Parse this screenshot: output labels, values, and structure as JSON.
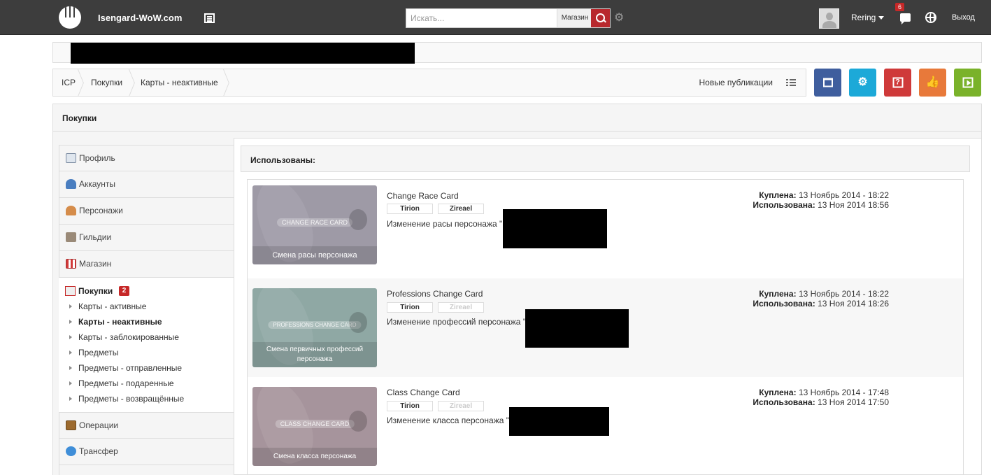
{
  "header": {
    "site_title": "Isengard-WoW.com",
    "search": {
      "placeholder": "Искать...",
      "scope": "Магазин"
    },
    "user": {
      "name": "Rering"
    },
    "notifications_count": "6",
    "logout": "Выход"
  },
  "breadcrumb": {
    "items": [
      "ICP",
      "Покупки",
      "Карты - неактивные"
    ],
    "new_publications": "Новые публикации"
  },
  "quick_buttons": [
    {
      "name": "shop",
      "color": "#3f5e9e"
    },
    {
      "name": "settings",
      "color": "#1ca9d8"
    },
    {
      "name": "help",
      "color": "#cf3a3a"
    },
    {
      "name": "vote",
      "color": "#e8793a"
    },
    {
      "name": "play",
      "color": "#7ab22a"
    }
  ],
  "section_title": "Покупки",
  "sidebar": {
    "top_items": [
      {
        "label": "Профиль",
        "icon": "profile-card-icon"
      },
      {
        "label": "Аккаунты",
        "icon": "accounts-icon"
      },
      {
        "label": "Персонажи",
        "icon": "characters-icon"
      },
      {
        "label": "Гильдии",
        "icon": "guild-icon"
      },
      {
        "label": "Магазин",
        "icon": "shop-icon"
      }
    ],
    "purchases": {
      "label": "Покупки",
      "badge": "2",
      "links": [
        "Карты - активные",
        "Карты - неактивные",
        "Карты - заблокированные",
        "Предметы",
        "Предметы - отправленные",
        "Предметы - подаренные",
        "Предметы - возвращённые"
      ],
      "active_index": 1
    },
    "bottom_items": [
      {
        "label": "Операции",
        "icon": "operations-icon"
      },
      {
        "label": "Трансфер",
        "icon": "transfer-icon"
      }
    ]
  },
  "used": {
    "title": "Использованы:",
    "purchased_label": "Куплена:",
    "used_label": "Использована:",
    "cards": [
      {
        "name": "Change Race Card",
        "stamp": "CHANGE RACE CARD",
        "caption": "Смена расы персонажа",
        "realms": [
          "Tirion",
          "Zireael"
        ],
        "realm_active": [
          true,
          true
        ],
        "description": "Изменение расы персонажа \"",
        "purchased": "13 Ноябрь 2014 - 18:22",
        "used": "13 Ноя 2014 18:56",
        "color": "#9e9aa6"
      },
      {
        "name": "Professions Change Card",
        "stamp": "PROFESSIONS CHANGE CARD",
        "caption": "Смена первичных профессий персонажа",
        "realms": [
          "Tirion",
          "Zireael"
        ],
        "realm_active": [
          true,
          false
        ],
        "description": "Изменение профессий персонажа \"",
        "purchased": "13 Ноябрь 2014 - 18:22",
        "used": "13 Ноя 2014 18:26",
        "color": "#8fa8a4"
      },
      {
        "name": "Class Change Card",
        "stamp": "CLASS CHANGE CARD",
        "caption": "Смена класса персонажа",
        "realms": [
          "Tirion",
          "Zireael"
        ],
        "realm_active": [
          true,
          false
        ],
        "description": "Изменение класса персонажа \"",
        "purchased": "13 Ноябрь 2014 - 17:48",
        "used": "13 Ноя 2014 17:50",
        "color": "#a6949c"
      }
    ]
  }
}
